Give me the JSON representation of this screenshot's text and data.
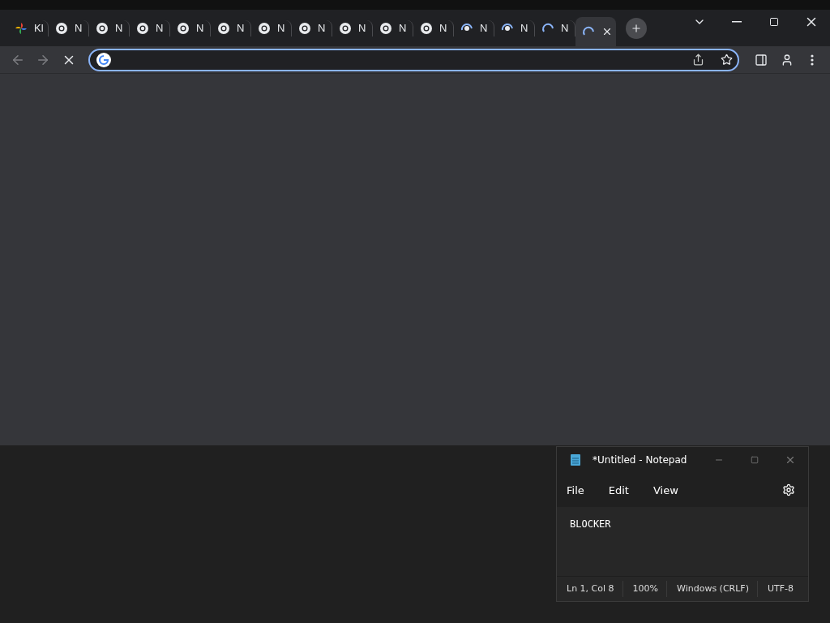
{
  "browser": {
    "tabs": [
      {
        "title": "Kl",
        "kind": "photos",
        "selected": false
      },
      {
        "title": "N",
        "kind": "chrome",
        "selected": false
      },
      {
        "title": "N",
        "kind": "chrome",
        "selected": false
      },
      {
        "title": "N",
        "kind": "chrome",
        "selected": false
      },
      {
        "title": "N",
        "kind": "chrome",
        "selected": false
      },
      {
        "title": "N",
        "kind": "chrome",
        "selected": false
      },
      {
        "title": "N",
        "kind": "chrome",
        "selected": false
      },
      {
        "title": "N",
        "kind": "chrome",
        "selected": false
      },
      {
        "title": "N",
        "kind": "chrome",
        "selected": false
      },
      {
        "title": "N",
        "kind": "chrome",
        "selected": false
      },
      {
        "title": "N",
        "kind": "chrome",
        "selected": false
      },
      {
        "title": "N",
        "kind": "loading",
        "selected": false
      },
      {
        "title": "N",
        "kind": "loading",
        "selected": false
      },
      {
        "title": "N",
        "kind": "spinner",
        "selected": false
      },
      {
        "kind": "spinner",
        "selected": true
      }
    ],
    "address_bar": {
      "focused": true
    }
  },
  "notepad": {
    "title": "*Untitled - Notepad",
    "menu": [
      "File",
      "Edit",
      "View"
    ],
    "text": "BLOCKER",
    "status_bar": [
      "Ln 1, Col 8",
      "100%",
      "Windows (CRLF)",
      "UTF-8"
    ]
  }
}
